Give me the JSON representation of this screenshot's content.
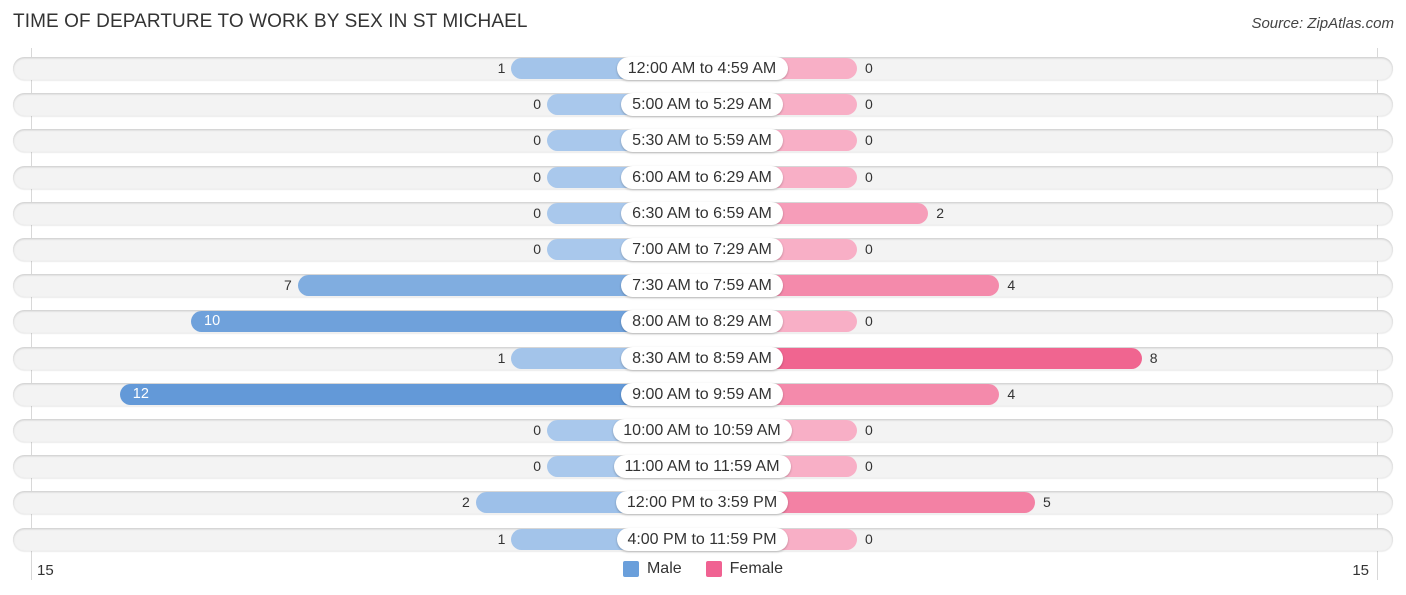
{
  "title": "TIME OF DEPARTURE TO WORK BY SEX IN ST MICHAEL",
  "source": "Source: ZipAtlas.com",
  "legend": [
    {
      "name": "Male",
      "color": "#6a9fdb"
    },
    {
      "name": "Female",
      "color": "#f06292"
    }
  ],
  "axis": {
    "left_label": "15",
    "right_label": "15"
  },
  "chart_data": {
    "type": "bar",
    "orientation": "horizontal-diverging",
    "title": "TIME OF DEPARTURE TO WORK BY SEX IN ST MICHAEL",
    "xlabel": "",
    "ylabel": "",
    "xlim": [
      -15,
      15
    ],
    "tick_labels": [
      "15",
      "15"
    ],
    "legend_position": "bottom-center",
    "categories": [
      "12:00 AM to 4:59 AM",
      "5:00 AM to 5:29 AM",
      "5:30 AM to 5:59 AM",
      "6:00 AM to 6:29 AM",
      "6:30 AM to 6:59 AM",
      "7:00 AM to 7:29 AM",
      "7:30 AM to 7:59 AM",
      "8:00 AM to 8:29 AM",
      "8:30 AM to 8:59 AM",
      "9:00 AM to 9:59 AM",
      "10:00 AM to 10:59 AM",
      "11:00 AM to 11:59 AM",
      "12:00 PM to 3:59 PM",
      "4:00 PM to 11:59 PM"
    ],
    "series": [
      {
        "name": "Male",
        "color": "#6a9fdb",
        "values": [
          1,
          0,
          0,
          0,
          0,
          0,
          7,
          10,
          1,
          12,
          0,
          0,
          2,
          1
        ]
      },
      {
        "name": "Female",
        "color": "#f06292",
        "values": [
          0,
          0,
          0,
          0,
          2,
          0,
          4,
          0,
          8,
          4,
          0,
          0,
          5,
          0
        ]
      }
    ]
  }
}
